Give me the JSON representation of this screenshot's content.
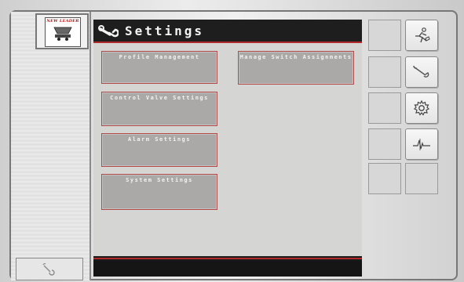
{
  "header": {
    "icon": "wrench-icon",
    "title": "Settings"
  },
  "logo": {
    "brand_text": "NEW LEADER",
    "icon": "spreader-icon"
  },
  "menu": {
    "left": [
      {
        "label": "Profile Management"
      },
      {
        "label": "Control Valve Settings"
      },
      {
        "label": "Alarm Settings"
      },
      {
        "label": "System Settings"
      }
    ],
    "right": [
      {
        "label": "Manage Switch Assignments"
      }
    ]
  },
  "sidebar_buttons": [
    {
      "icon": "operator-running-icon"
    },
    {
      "icon": "wrench-icon"
    },
    {
      "icon": "gear-icon"
    },
    {
      "icon": "diagnostics-waveform-icon"
    }
  ],
  "left_button": {
    "icon": "wrench-icon"
  },
  "colors": {
    "accent_red": "#b12a2a",
    "button_gray": "#aaa9a7",
    "content_bg": "#d5d6d3",
    "title_bg": "#1e1e1e"
  }
}
